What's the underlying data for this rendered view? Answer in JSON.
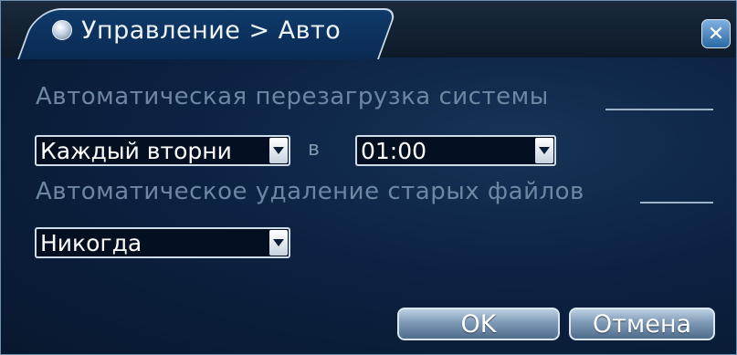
{
  "dialog": {
    "title": "Управление > Авто",
    "close_symbol": "✕"
  },
  "reboot": {
    "label": "Автоматическая перезагрузка системы",
    "day_value": "Каждый вторни",
    "at_label": "в",
    "time_value": "01:00"
  },
  "delete_old": {
    "label": "Автоматическое удаление старых файлов",
    "value": "Никогда"
  },
  "buttons": {
    "ok": "OK",
    "cancel": "Отмена"
  },
  "icons": {
    "title": "camera-lens-icon",
    "close": "close-icon",
    "dropdown": "chevron-down-icon"
  },
  "colors": {
    "background": "#0c2242",
    "label_text": "#6d87a3",
    "field_border": "#cfdcea"
  }
}
